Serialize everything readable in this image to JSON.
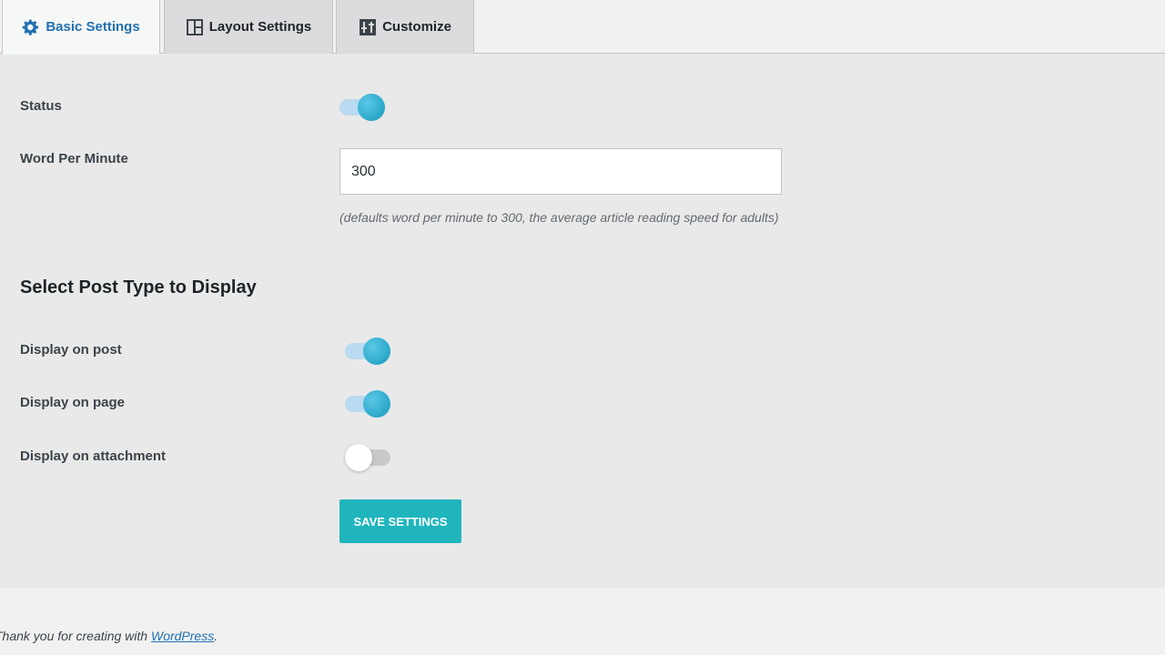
{
  "tabs": [
    {
      "label": "Basic Settings",
      "icon": "gear-icon",
      "active": true
    },
    {
      "label": "Layout Settings",
      "icon": "layout-icon",
      "active": false
    },
    {
      "label": "Customize",
      "icon": "customize-icon",
      "active": false
    }
  ],
  "status": {
    "label": "Status",
    "enabled": true
  },
  "wpm": {
    "label": "Word Per Minute",
    "value": "300",
    "hint": "(defaults word per minute to 300, the average article reading speed for adults)"
  },
  "post_types": {
    "title": "Select Post Type to Display",
    "items": [
      {
        "label": "Display on post",
        "enabled": true
      },
      {
        "label": "Display on page",
        "enabled": true
      },
      {
        "label": "Display on attachment",
        "enabled": false
      }
    ]
  },
  "save_label": "SAVE SETTINGS",
  "footer": {
    "prefix": "Thank you for creating with ",
    "link": "WordPress",
    "suffix": "."
  },
  "colors": {
    "accent": "#2271b1",
    "toggle_on": "#2aa7c9",
    "button": "#20b5bd"
  }
}
